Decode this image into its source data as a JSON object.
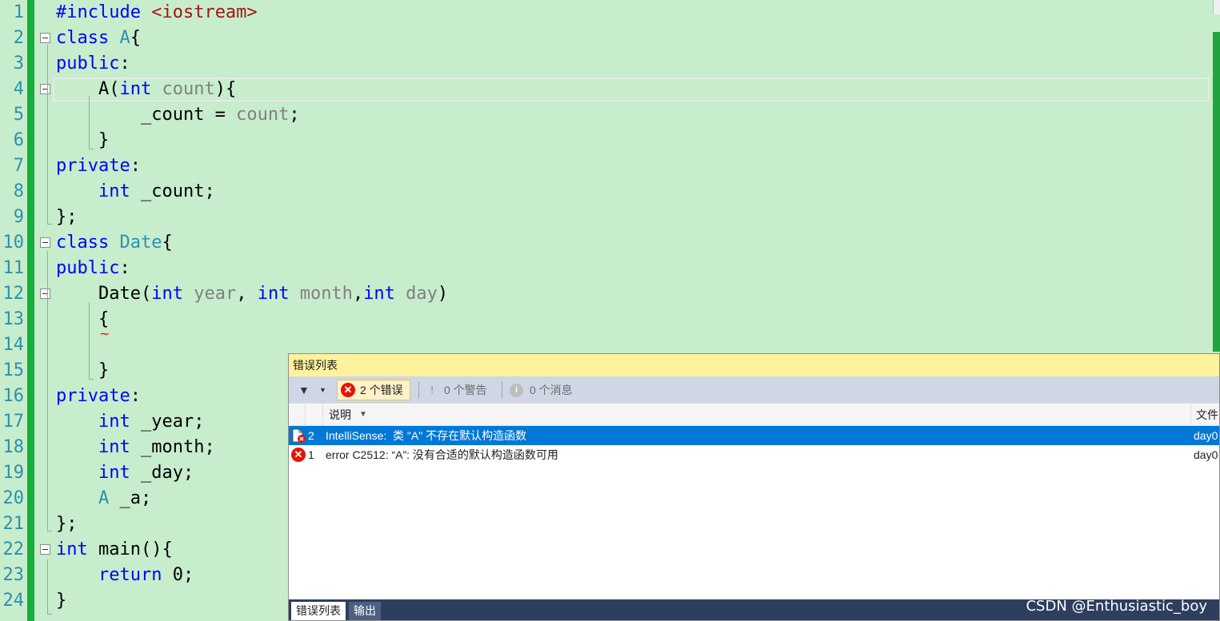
{
  "editor": {
    "lines": [
      {
        "num": "1",
        "segments": [
          {
            "t": "#include ",
            "c": "kw"
          },
          {
            "t": "<iostream>",
            "c": "inc"
          }
        ]
      },
      {
        "num": "2",
        "segments": [
          {
            "t": "class ",
            "c": "kw"
          },
          {
            "t": "A",
            "c": "cls"
          },
          {
            "t": "{",
            "c": ""
          }
        ]
      },
      {
        "num": "3",
        "segments": [
          {
            "t": "public",
            "c": "kw"
          },
          {
            "t": ":",
            "c": ""
          }
        ]
      },
      {
        "num": "4",
        "segments": [
          {
            "t": "    A(",
            "c": ""
          },
          {
            "t": "int",
            "c": "kw"
          },
          {
            "t": " count",
            "c": "par"
          },
          {
            "t": "){",
            "c": ""
          }
        ]
      },
      {
        "num": "5",
        "segments": [
          {
            "t": "        _count = ",
            "c": ""
          },
          {
            "t": "count",
            "c": "par"
          },
          {
            "t": ";",
            "c": ""
          }
        ]
      },
      {
        "num": "6",
        "segments": [
          {
            "t": "    }",
            "c": ""
          }
        ]
      },
      {
        "num": "7",
        "segments": [
          {
            "t": "private",
            "c": "kw"
          },
          {
            "t": ":",
            "c": ""
          }
        ]
      },
      {
        "num": "8",
        "segments": [
          {
            "t": "    ",
            "c": ""
          },
          {
            "t": "int",
            "c": "kw"
          },
          {
            "t": " _count;",
            "c": ""
          }
        ]
      },
      {
        "num": "9",
        "segments": [
          {
            "t": "};",
            "c": ""
          }
        ]
      },
      {
        "num": "10",
        "segments": [
          {
            "t": "class ",
            "c": "kw"
          },
          {
            "t": "Date",
            "c": "cls"
          },
          {
            "t": "{",
            "c": ""
          }
        ]
      },
      {
        "num": "11",
        "segments": [
          {
            "t": "public",
            "c": "kw"
          },
          {
            "t": ":",
            "c": ""
          }
        ]
      },
      {
        "num": "12",
        "segments": [
          {
            "t": "    Date(",
            "c": ""
          },
          {
            "t": "int",
            "c": "kw"
          },
          {
            "t": " year",
            "c": "par"
          },
          {
            "t": ", ",
            "c": ""
          },
          {
            "t": "int",
            "c": "kw"
          },
          {
            "t": " month",
            "c": "par"
          },
          {
            "t": ",",
            "c": ""
          },
          {
            "t": "int",
            "c": "kw"
          },
          {
            "t": " day",
            "c": "par"
          },
          {
            "t": ")",
            "c": ""
          }
        ]
      },
      {
        "num": "13",
        "segments": [
          {
            "t": "    {",
            "c": ""
          }
        ]
      },
      {
        "num": "14",
        "segments": []
      },
      {
        "num": "15",
        "segments": [
          {
            "t": "    }",
            "c": ""
          }
        ]
      },
      {
        "num": "16",
        "segments": [
          {
            "t": "private",
            "c": "kw"
          },
          {
            "t": ":",
            "c": ""
          }
        ]
      },
      {
        "num": "17",
        "segments": [
          {
            "t": "    ",
            "c": ""
          },
          {
            "t": "int",
            "c": "kw"
          },
          {
            "t": " _year;",
            "c": ""
          }
        ]
      },
      {
        "num": "18",
        "segments": [
          {
            "t": "    ",
            "c": ""
          },
          {
            "t": "int",
            "c": "kw"
          },
          {
            "t": " _month;",
            "c": ""
          }
        ]
      },
      {
        "num": "19",
        "segments": [
          {
            "t": "    ",
            "c": ""
          },
          {
            "t": "int",
            "c": "kw"
          },
          {
            "t": " _day;",
            "c": ""
          }
        ]
      },
      {
        "num": "20",
        "segments": [
          {
            "t": "    ",
            "c": ""
          },
          {
            "t": "A",
            "c": "cls"
          },
          {
            "t": " _a;",
            "c": ""
          }
        ]
      },
      {
        "num": "21",
        "segments": [
          {
            "t": "};",
            "c": ""
          }
        ]
      },
      {
        "num": "22",
        "segments": [
          {
            "t": "int",
            "c": "kw"
          },
          {
            "t": " main(){",
            "c": ""
          }
        ]
      },
      {
        "num": "23",
        "segments": [
          {
            "t": "    ",
            "c": ""
          },
          {
            "t": "return",
            "c": "kw"
          },
          {
            "t": " 0;",
            "c": ""
          }
        ]
      },
      {
        "num": "24",
        "segments": [
          {
            "t": "}",
            "c": ""
          }
        ]
      }
    ],
    "fold_lines": [
      2,
      4,
      10,
      12,
      22
    ],
    "colors": {
      "background": "#C7EDCC",
      "keyword": "#0000FF",
      "class_name": "#2B91AF",
      "parameter": "#808080",
      "include_path": "#A31515",
      "change_bar": "#14AE38"
    }
  },
  "error_list": {
    "title": "错误列表",
    "toolbar": {
      "errors_label": "2 个错误",
      "warnings_label": "0 个警告",
      "messages_label": "0 个消息"
    },
    "columns": {
      "description": "说明",
      "file": "文件"
    },
    "rows": [
      {
        "code": "2",
        "description": "IntelliSense:  类 \"A\" 不存在默认构造函数",
        "file": "day0",
        "icon": "intellisense-error-icon",
        "selected": true
      },
      {
        "code": "1",
        "description": "error C2512: “A”: 没有合适的默认构造函数可用",
        "file": "day0",
        "icon": "error-icon",
        "selected": false
      }
    ],
    "tabs": [
      {
        "label": "错误列表",
        "active": true
      },
      {
        "label": "输出",
        "active": false
      }
    ]
  },
  "watermark": "CSDN @Enthusiastic_boy"
}
